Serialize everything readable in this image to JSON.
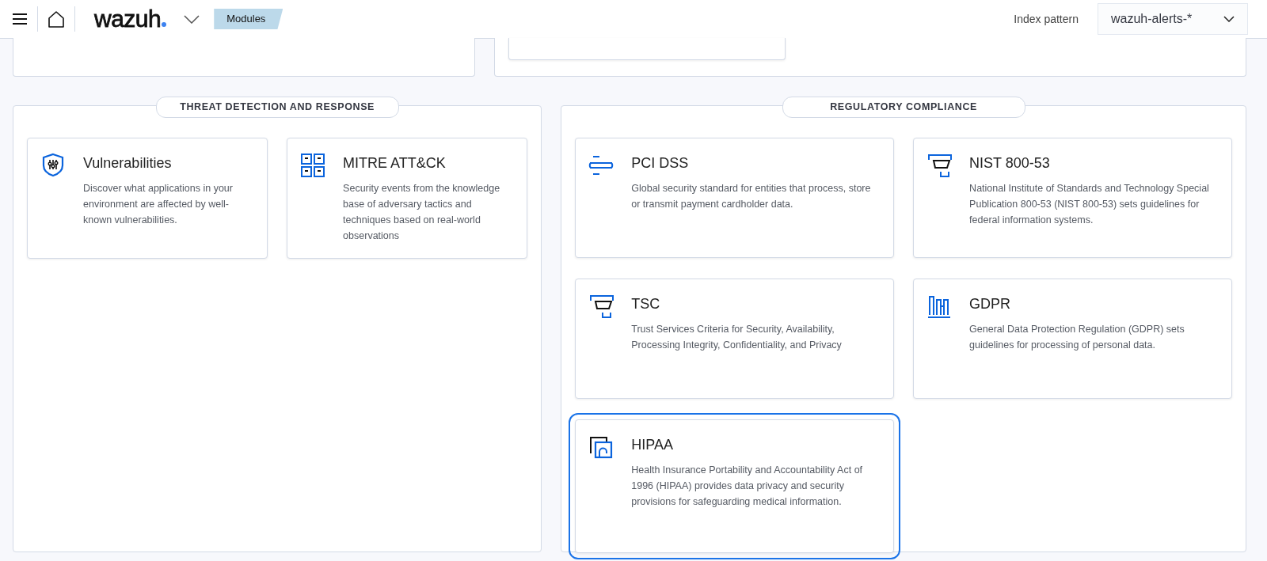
{
  "header": {
    "logo": "wazuh",
    "breadcrumb": "Modules",
    "index_pattern_label": "Index pattern",
    "index_pattern_value": "wazuh-alerts-*"
  },
  "sections": [
    {
      "title": "THREAT DETECTION AND RESPONSE",
      "cards": [
        {
          "kind": "shield",
          "title": "Vulnerabilities",
          "description": "Discover what applications in your environment are affected by well-known vulnerabilities.",
          "selected": false
        },
        {
          "kind": "grid",
          "title": "MITRE ATT&CK",
          "description": "Security events from the knowledge base of adversary tactics and techniques based on real-world observations",
          "selected": false
        }
      ]
    },
    {
      "title": "REGULATORY COMPLIANCE",
      "cards": [
        {
          "kind": "lines",
          "title": "PCI DSS",
          "description": "Global security standard for entities that process, store or transmit payment cardholder data.",
          "selected": false
        },
        {
          "kind": "bracket",
          "title": "NIST 800-53",
          "description": "National Institute of Standards and Technology Special Publication 800-53 (NIST 800-53) sets guidelines for federal information systems.",
          "selected": false
        },
        {
          "kind": "bracket",
          "title": "TSC",
          "description": "Trust Services Criteria for Security, Availability, Processing Integrity, Confidentiality, and Privacy",
          "selected": false
        },
        {
          "kind": "columns",
          "title": "GDPR",
          "description": "General Data Protection Regulation (GDPR) sets guidelines for processing of personal data.",
          "selected": false
        },
        {
          "kind": "frames",
          "title": "HIPAA",
          "description": "Health Insurance Portability and Accountability Act of 1996 (HIPAA) provides data privacy and security provisions for safeguarding medical information.",
          "selected": true
        }
      ]
    }
  ]
}
